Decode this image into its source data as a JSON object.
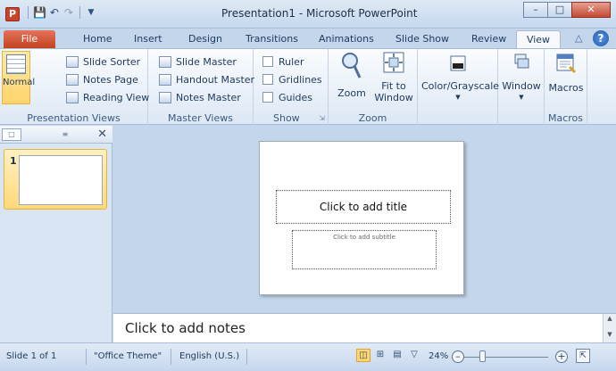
{
  "titlebar": {
    "app_icon": "P",
    "title": "Presentation1 - Microsoft PowerPoint",
    "qat": [
      "save-icon",
      "undo-icon",
      "redo-icon",
      "customize-icon"
    ],
    "window_buttons": [
      "–",
      "□",
      "✕"
    ]
  },
  "tabs": [
    {
      "label": "File"
    },
    {
      "label": "Home"
    },
    {
      "label": "Insert"
    },
    {
      "label": "Design"
    },
    {
      "label": "Transitions"
    },
    {
      "label": "Animations"
    },
    {
      "label": "Slide Show"
    },
    {
      "label": "Review"
    },
    {
      "label": "View"
    }
  ],
  "ribbon": {
    "presentation_views": {
      "label": "Presentation Views",
      "normal": "Normal",
      "slide_sorter": "Slide Sorter",
      "notes_page": "Notes Page",
      "reading_view": "Reading View"
    },
    "master_views": {
      "label": "Master Views",
      "slide_master": "Slide Master",
      "handout_master": "Handout Master",
      "notes_master": "Notes Master"
    },
    "show": {
      "label": "Show",
      "ruler": "Ruler",
      "gridlines": "Gridlines",
      "guides": "Guides"
    },
    "zoom": {
      "label": "Zoom",
      "zoom": "Zoom",
      "fit_to_window_1": "Fit to",
      "fit_to_window_2": "Window"
    },
    "color": {
      "color_grayscale": "Color/Grayscale"
    },
    "window": {
      "window": "Window"
    },
    "macros": {
      "label": "Macros",
      "macros": "Macros"
    }
  },
  "slides_pane": {
    "slide_number": "1"
  },
  "slide": {
    "title_placeholder": "Click to add title",
    "subtitle_placeholder": "Click to add subtitle"
  },
  "notes": {
    "placeholder": "Click to add notes"
  },
  "statusbar": {
    "slide_info": "Slide 1 of 1",
    "theme": "\"Office Theme\"",
    "language": "English (U.S.)",
    "zoom_level": "24%",
    "zoom_out": "–",
    "zoom_in": "+"
  },
  "colors": {
    "file_tab": "#c3431f",
    "accent_selected": "#ffd46a",
    "ribbon_bg": "#dde8f5"
  }
}
